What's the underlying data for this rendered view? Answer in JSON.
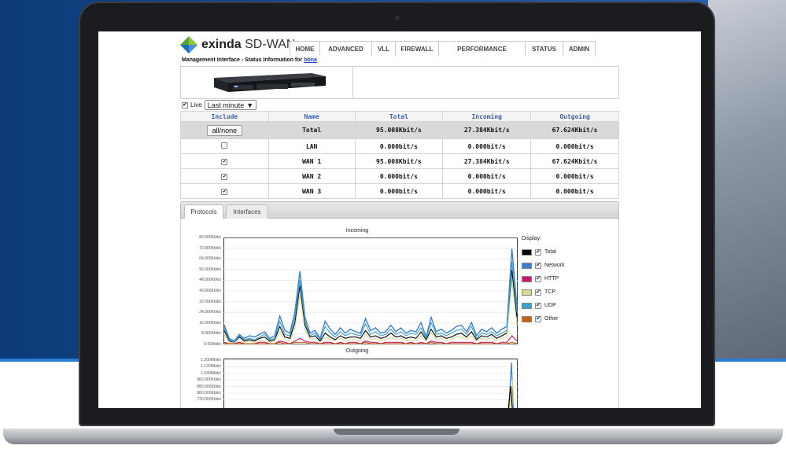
{
  "brand": {
    "name_bold": "exinda",
    "name_rest": " SD-WAN"
  },
  "nav": [
    "HOME",
    "ADVANCED",
    "VLL",
    "FIREWALL",
    "PERFORMANCE",
    "STATUS",
    "ADMIN"
  ],
  "page": {
    "title_prefix": "Management Interface - Status Information for ",
    "host": "bbna"
  },
  "live": {
    "label": "Live",
    "checked": true,
    "range": "Last minute"
  },
  "table": {
    "headers": [
      "Include",
      "Name",
      "Total",
      "Incoming",
      "Outgoing"
    ],
    "allnone_label": "all/none",
    "rows": [
      {
        "name": "Total",
        "total": "95.008Kbit/s",
        "incoming": "27.384Kbit/s",
        "outgoing": "67.624Kbit/s"
      },
      {
        "name": "LAN",
        "checked": false,
        "total": "0.000bit/s",
        "incoming": "0.000bit/s",
        "outgoing": "0.000bit/s"
      },
      {
        "name": "WAN 1",
        "checked": true,
        "total": "95.008Kbit/s",
        "incoming": "27.384Kbit/s",
        "outgoing": "67.624Kbit/s"
      },
      {
        "name": "WAN 2",
        "checked": true,
        "total": "0.000bit/s",
        "incoming": "0.000bit/s",
        "outgoing": "0.000bit/s"
      },
      {
        "name": "WAN 3",
        "checked": true,
        "total": "0.000bit/s",
        "incoming": "0.000bit/s",
        "outgoing": "0.000bit/s"
      }
    ]
  },
  "tabs": [
    "Protocols",
    "Interfaces"
  ],
  "legend": {
    "title": "Display:",
    "items": [
      {
        "label": "Total",
        "color": "#000000"
      },
      {
        "label": "Network",
        "color": "#3a7fd0"
      },
      {
        "label": "HTTP",
        "color": "#c8186a"
      },
      {
        "label": "TCP",
        "color": "#d8d890"
      },
      {
        "label": "UDP",
        "color": "#3aa0cc"
      },
      {
        "label": "Other",
        "color": "#c86010"
      }
    ]
  },
  "chart_data": [
    {
      "type": "line",
      "title": "Incoming",
      "yticks": [
        "80.000Kbit/s",
        "72.000Kbit/s",
        "64.000Kbit/s",
        "56.000Kbit/s",
        "48.000Kbit/s",
        "40.000Kbit/s",
        "32.000Kbit/s",
        "24.000Kbit/s",
        "16.000Kbit/s",
        "8.000Kbit/s",
        "0.000bit/s"
      ],
      "ylim": [
        0,
        80
      ],
      "series": [
        {
          "name": "Network",
          "values": [
            14,
            4,
            2,
            7,
            4,
            6,
            5,
            7,
            9,
            4,
            6,
            21,
            10,
            8,
            24,
            55,
            20,
            8,
            10,
            4,
            17,
            11,
            7,
            12,
            8,
            11,
            9,
            8,
            19,
            10,
            12,
            8,
            9,
            14,
            9,
            12,
            8,
            10,
            9,
            16,
            5,
            20,
            9,
            11,
            8,
            10,
            13,
            14,
            9,
            16,
            6,
            11,
            9,
            12,
            8,
            11,
            13,
            72,
            28
          ]
        },
        {
          "name": "Total",
          "values": [
            10,
            2,
            1,
            5,
            2,
            3,
            2,
            4,
            5,
            2,
            3,
            13,
            5,
            4,
            16,
            44,
            14,
            5,
            6,
            2,
            8,
            5,
            3,
            6,
            4,
            5,
            5,
            4,
            10,
            5,
            6,
            4,
            5,
            8,
            5,
            6,
            4,
            5,
            4,
            9,
            3,
            11,
            5,
            6,
            4,
            5,
            7,
            8,
            5,
            9,
            3,
            6,
            5,
            7,
            4,
            6,
            8,
            56,
            20
          ]
        },
        {
          "name": "UDP",
          "values": [
            12,
            3,
            1,
            6,
            3,
            4,
            3,
            5,
            7,
            3,
            4,
            17,
            7,
            6,
            20,
            48,
            17,
            6,
            8,
            3,
            13,
            8,
            5,
            9,
            6,
            8,
            7,
            6,
            15,
            7,
            9,
            6,
            7,
            11,
            7,
            9,
            6,
            8,
            7,
            12,
            4,
            16,
            7,
            8,
            6,
            8,
            10,
            11,
            7,
            13,
            4,
            8,
            7,
            9,
            6,
            8,
            10,
            62,
            24
          ]
        },
        {
          "name": "TCP",
          "values": [
            7,
            1,
            0,
            3,
            1,
            2,
            1,
            2,
            3,
            1,
            2,
            9,
            3,
            2,
            12,
            37,
            10,
            3,
            4,
            1,
            5,
            3,
            2,
            4,
            2,
            3,
            3,
            2,
            7,
            3,
            4,
            2,
            3,
            5,
            3,
            4,
            2,
            3,
            2,
            6,
            2,
            8,
            3,
            4,
            2,
            3,
            5,
            5,
            3,
            6,
            2,
            4,
            3,
            5,
            2,
            4,
            5,
            48,
            14
          ]
        },
        {
          "name": "HTTP",
          "values": [
            1,
            0,
            0,
            1,
            0,
            0,
            0,
            1,
            1,
            0,
            0,
            2,
            1,
            0,
            2,
            4,
            2,
            1,
            1,
            0,
            1,
            1,
            0,
            1,
            0,
            1,
            1,
            0,
            2,
            1,
            1,
            0,
            1,
            1,
            1,
            1,
            0,
            1,
            0,
            1,
            0,
            2,
            1,
            1,
            0,
            1,
            1,
            1,
            1,
            1,
            0,
            1,
            1,
            1,
            0,
            1,
            1,
            6,
            2
          ]
        },
        {
          "name": "Other",
          "values": [
            0,
            0,
            0,
            0,
            0,
            0,
            0,
            0,
            0,
            0,
            0,
            1,
            0,
            0,
            1,
            1,
            1,
            0,
            0,
            0,
            0,
            0,
            0,
            0,
            0,
            0,
            0,
            0,
            1,
            0,
            0,
            0,
            0,
            0,
            0,
            0,
            0,
            0,
            0,
            0,
            0,
            1,
            0,
            0,
            0,
            0,
            0,
            0,
            0,
            0,
            0,
            0,
            0,
            0,
            0,
            0,
            0,
            1,
            0
          ]
        }
      ]
    },
    {
      "type": "line",
      "title": "Outgoing",
      "yticks": [
        "1.200Mbit/s",
        "1.120Mbit/s",
        "1.040Mbit/s",
        "960.000Kbit/s",
        "880.000Kbit/s",
        "800.000Kbit/s",
        "720.000Kbit/s"
      ],
      "ylim_visible": [
        720,
        1200
      ],
      "spike": {
        "series": "Network",
        "value_kbit": 1170
      }
    }
  ]
}
